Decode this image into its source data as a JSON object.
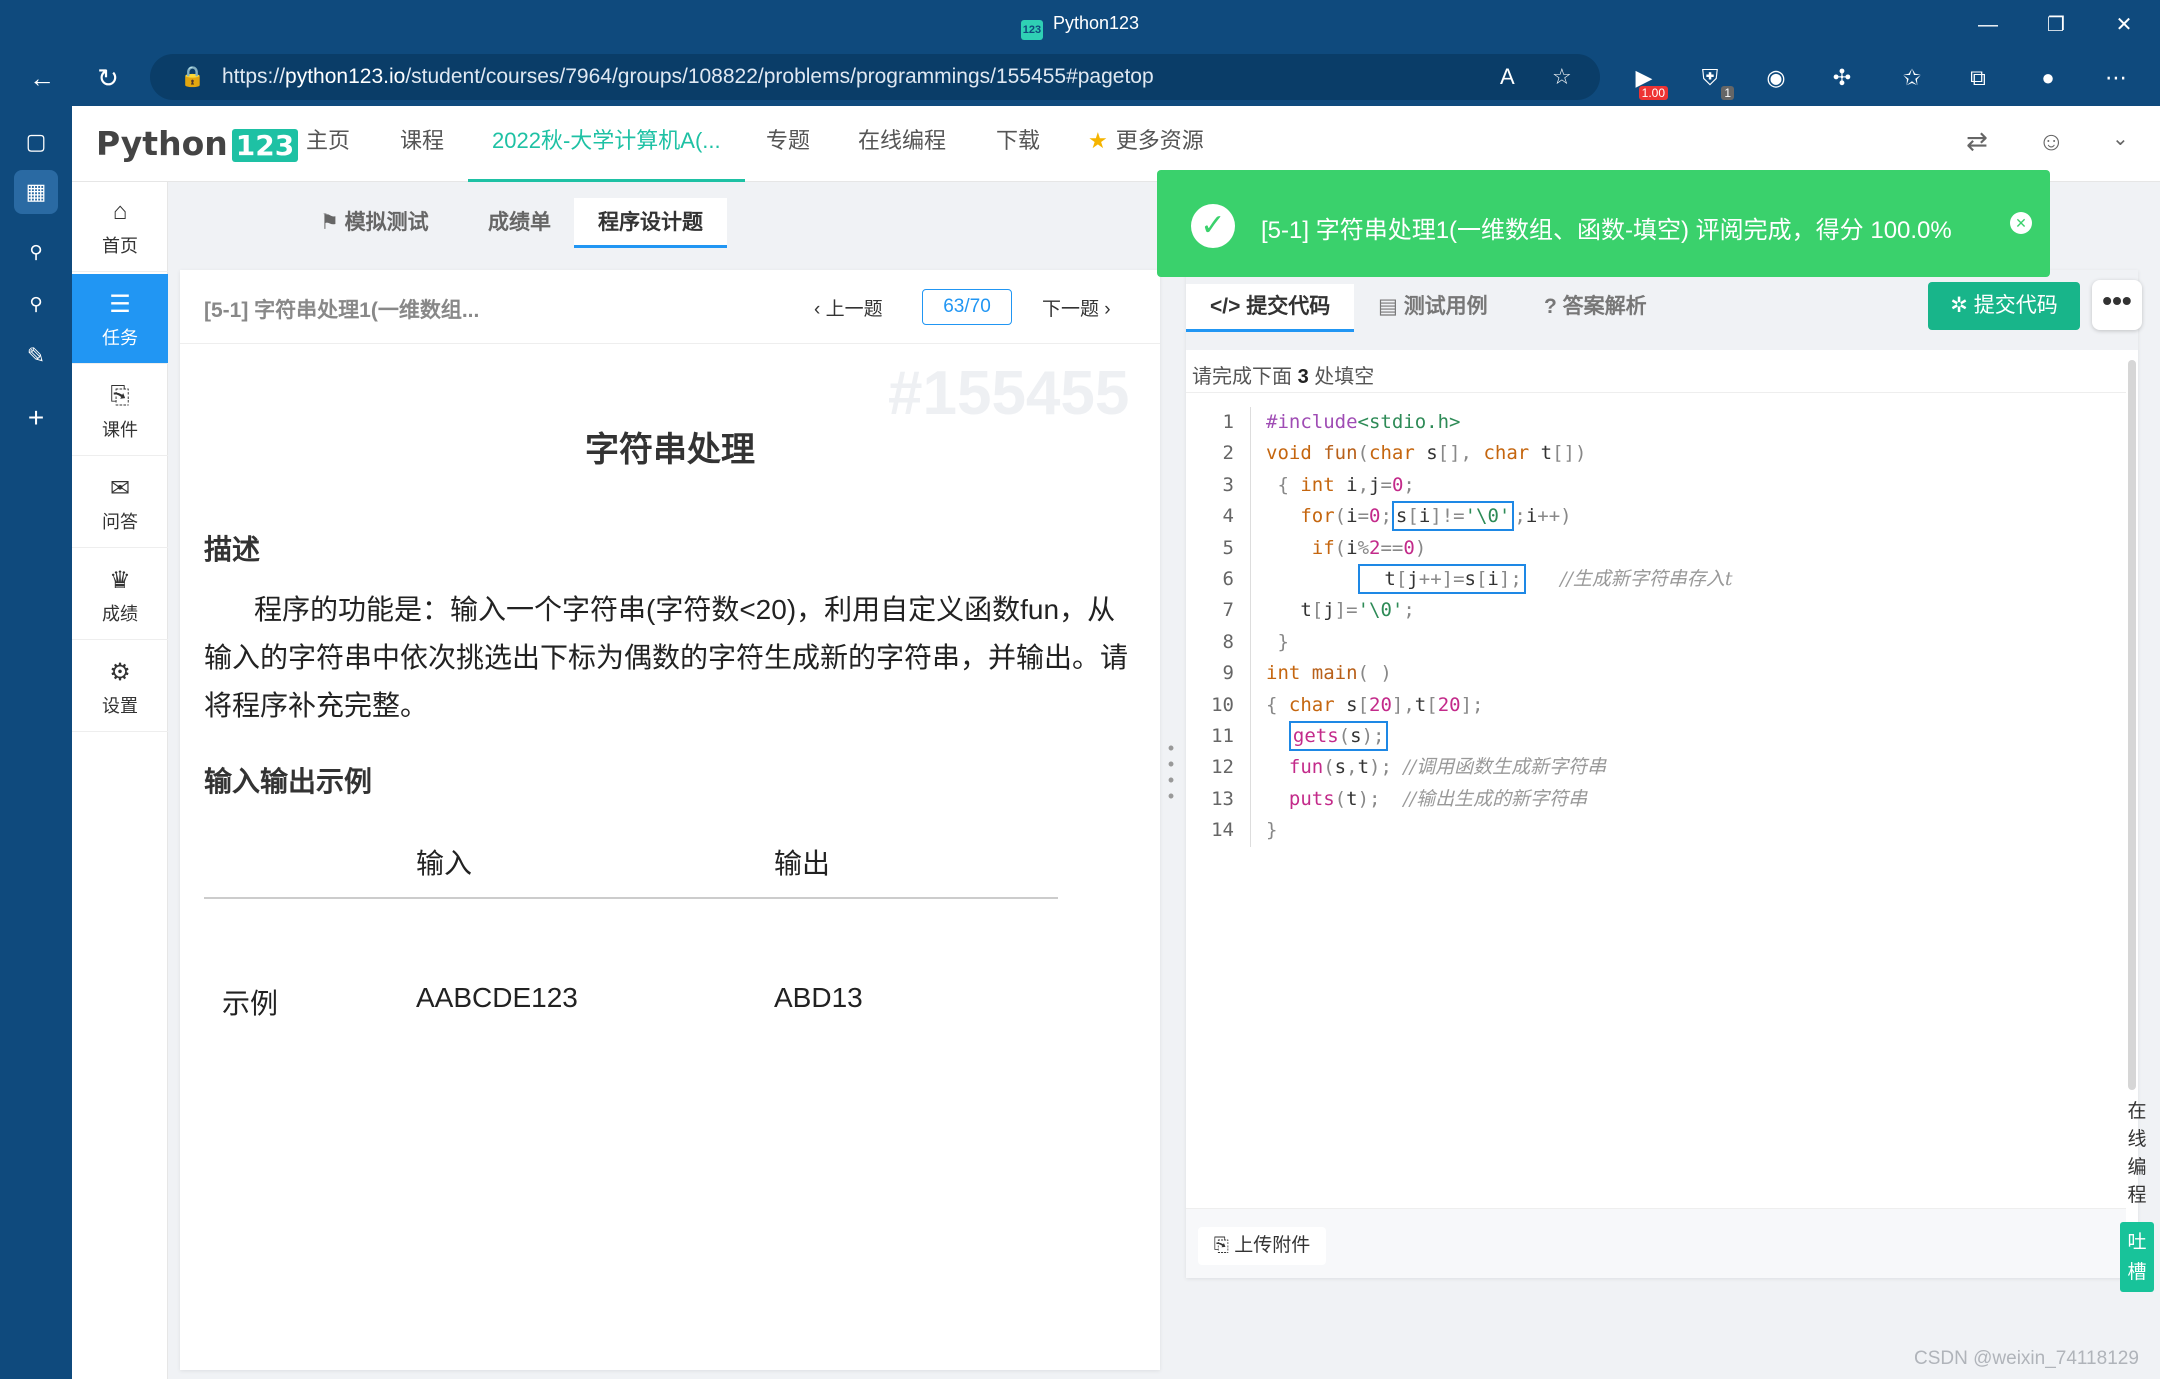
{
  "window": {
    "title": "Python123",
    "app_icon": "123"
  },
  "browser": {
    "url_prefix": "https://",
    "url_domain": "python123.io",
    "url_path": "/student/courses/7964/groups/108822/problems/programmings/155455#pagetop",
    "ext_badges": {
      "zoom": "1.00",
      "ublock": "1"
    }
  },
  "header": {
    "logo_text": "Python",
    "logo_num": "123",
    "nav": [
      "主页",
      "课程",
      "2022秋-大学计算机A(...",
      "专题",
      "在线编程",
      "下载",
      "更多资源"
    ]
  },
  "leftnav": {
    "items": [
      {
        "label": "首页",
        "icon": "home-icon"
      },
      {
        "label": "任务",
        "icon": "tasks-icon"
      },
      {
        "label": "课件",
        "icon": "paperclip-icon"
      },
      {
        "label": "问答",
        "icon": "chat-icon"
      },
      {
        "label": "成绩",
        "icon": "trophy-icon"
      },
      {
        "label": "设置",
        "icon": "gear-icon"
      }
    ]
  },
  "subtabs": [
    "模拟测试",
    "成绩单",
    "程序设计题"
  ],
  "problem": {
    "short_title": "[5-1] 字符串处理1(一维数组...",
    "prev": "上一题",
    "page": "63/70",
    "next": "下一题",
    "watermark": "#155455",
    "title": "字符串处理",
    "desc_heading": "描述",
    "desc": "程序的功能是：输入一个字符串(字符数<20)，利用自定义函数fun，从输入的字符串中依次挑选出下标为偶数的字符生成新的字符串，并输出。请将程序补充完整。",
    "io_heading": "输入输出示例",
    "io_table": {
      "header_in": "输入",
      "header_out": "输出",
      "row_label": "示例",
      "input": "AABCDE123",
      "output": "ABD13"
    }
  },
  "editor": {
    "tabs": [
      "提交代码",
      "测试用例",
      "答案解析"
    ],
    "submit_label": "提交代码",
    "more_label": "•••",
    "hint_pre": "请完成下面",
    "hint_num": "3",
    "hint_post": "处填空",
    "upload_label": "上传附件"
  },
  "toast": {
    "message": "[5-1] 字符串处理1(一维数组、函数-填空) 评阅完成，得分 100.0%",
    "color": "#3ad16c"
  },
  "side": {
    "online_code": "在线编程",
    "feedback": "吐槽"
  },
  "watermark_csdn": "CSDN @weixin_74118129"
}
